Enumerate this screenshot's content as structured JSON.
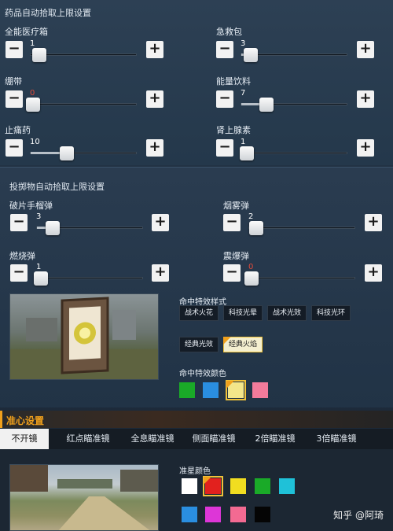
{
  "medicine": {
    "title": "药品自动拾取上限设置",
    "items": [
      {
        "label": "全能医疗箱",
        "value": "1",
        "fill": 0.08
      },
      {
        "label": "急救包",
        "value": "3",
        "fill": 0.09
      },
      {
        "label": "绷带",
        "value": "0",
        "fill": 0.0
      },
      {
        "label": "能量饮料",
        "value": "7",
        "fill": 0.24
      },
      {
        "label": "止痛药",
        "value": "10",
        "fill": 0.34
      },
      {
        "label": "肾上腺素",
        "value": "1",
        "fill": 0.05
      }
    ]
  },
  "throwables": {
    "title": "投掷物自动拾取上限设置",
    "items": [
      {
        "label": "破片手榴弹",
        "value": "3",
        "fill": 0.15
      },
      {
        "label": "烟雾弹",
        "value": "2",
        "fill": 0.07
      },
      {
        "label": "燃烧弹",
        "value": "1",
        "fill": 0.04
      },
      {
        "label": "震爆弹",
        "value": "0",
        "fill": 0.0
      }
    ],
    "minus": "−",
    "plus": "+"
  },
  "hit_effect": {
    "style_label": "命中特效样式",
    "styles": [
      "战术火花",
      "科技光晕",
      "战术光效",
      "科技光环",
      "经典光效",
      "经典火焰"
    ],
    "selected_style": "经典火焰",
    "color_label": "命中特效颜色",
    "colors": [
      "#1aaa28",
      "#2a8ee0",
      "#f3e68a",
      "#f37b9b"
    ],
    "selected_color_index": 2
  },
  "crosshair": {
    "title": "准心设置",
    "tabs": [
      "不开镜",
      "红点瞄准镜",
      "全息瞄准镜",
      "侧面瞄准镜",
      "2倍瞄准镜",
      "3倍瞄准镜"
    ],
    "active_tab": "不开镜",
    "color_label": "准星颜色",
    "colors": [
      "#ffffff",
      "#e2211e",
      "#f1dd20",
      "#1aaa28",
      "#1fc1d8",
      "#2a8ee0",
      "#dd36d7",
      "#f36a92",
      "#050505"
    ],
    "selected_color_index": 1
  },
  "watermark": "知乎 @阿琦"
}
